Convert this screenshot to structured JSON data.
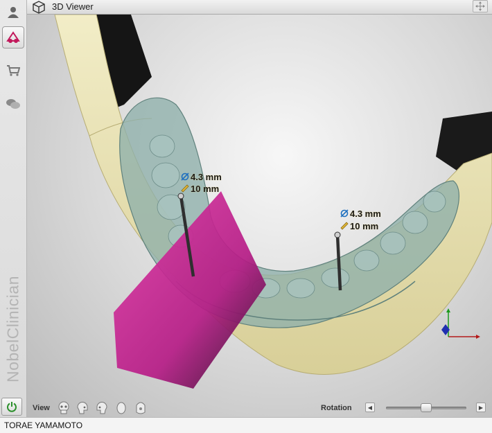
{
  "window": {
    "title": "3D Viewer"
  },
  "sidebar": {
    "brand": "NobelClinician",
    "items": [
      {
        "icon": "user-icon"
      },
      {
        "icon": "implant-plan-icon"
      },
      {
        "icon": "cart-icon"
      },
      {
        "icon": "chat-icon"
      }
    ],
    "power_icon": "power-icon"
  },
  "implants": [
    {
      "diameter": "4.3 mm",
      "length": "10 mm"
    },
    {
      "diameter": "4.3 mm",
      "length": "10 mm"
    }
  ],
  "toolbar": {
    "view_label": "View",
    "view_icons": [
      "skull-front-icon",
      "skull-left-icon",
      "skull-right-icon",
      "skull-top-icon",
      "skull-bottom-icon"
    ],
    "rotation_label": "Rotation",
    "rotation_value": 0.5
  },
  "status": {
    "patient": "TORAE YAMAMOTO"
  },
  "colors": {
    "bone": "#e8e2b6",
    "guide": "#8aa7a3",
    "slice": "#c3208c",
    "accent": "#2a8f2a"
  }
}
